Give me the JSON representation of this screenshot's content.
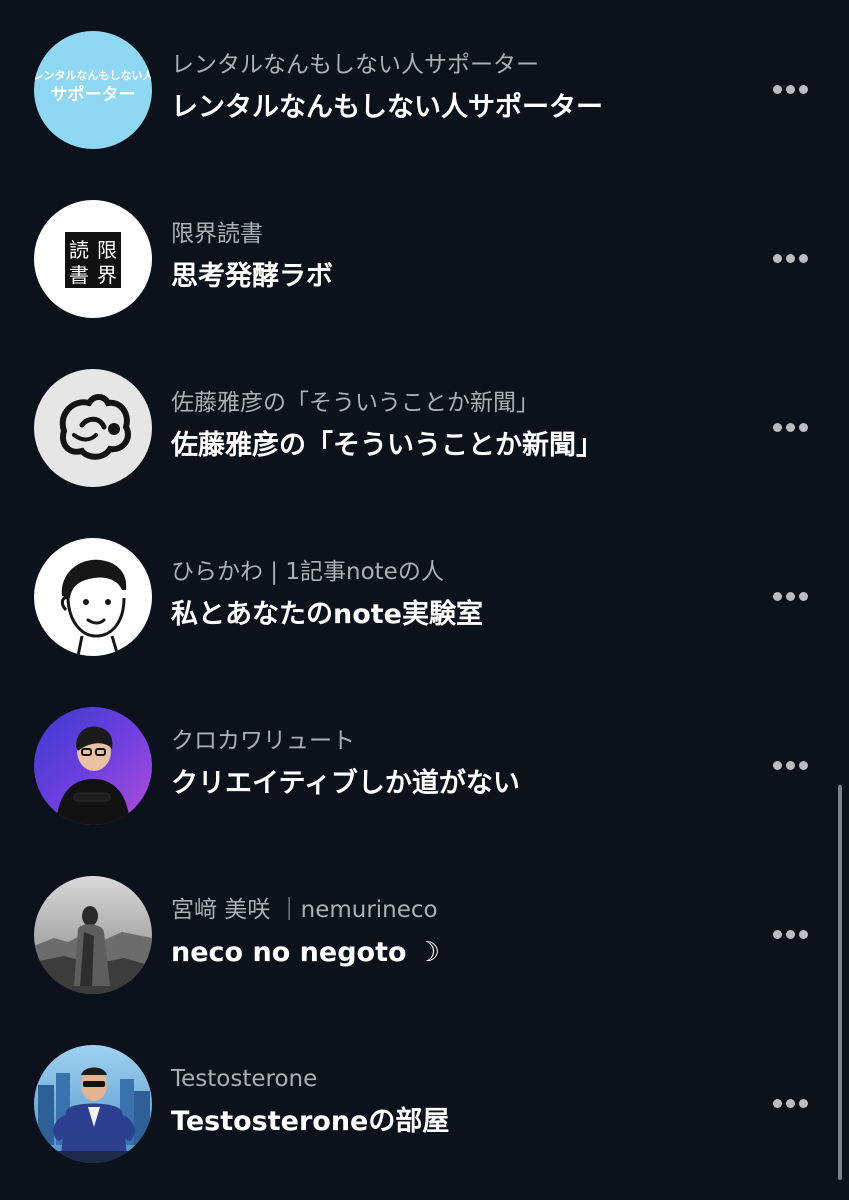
{
  "items": [
    {
      "author": "レンタルなんもしない人サポーター",
      "title": "レンタルなんもしない人サポーター",
      "avatar_text": [
        "レンタルなんもしない人",
        "サポーター"
      ],
      "avatar_icon": "text-logo-icon"
    },
    {
      "author": "限界読書",
      "title": "思考発酵ラボ",
      "avatar_text": [
        "読",
        "限",
        "書",
        "界"
      ],
      "avatar_icon": "book-logo-icon"
    },
    {
      "author": "佐藤雅彦の「そういうことか新聞」",
      "title": "佐藤雅彦の「そういうことか新聞」",
      "avatar_icon": "ink-drawing-icon"
    },
    {
      "author": "ひらかわ | 1記事noteの人",
      "title": "私とあなたのnote実験室",
      "avatar_icon": "face-illustration-icon"
    },
    {
      "author": "クロカワリュート",
      "title": "クリエイティブしか道がない",
      "avatar_icon": "person-photo-icon"
    },
    {
      "author": "宮﨑 美咲 ｜nemurineco",
      "title": "neco no negoto ☽",
      "avatar_icon": "monochrome-photo-icon"
    },
    {
      "author": "Testosterone",
      "title": "Testosteroneの部屋",
      "avatar_icon": "cartoon-muscle-icon"
    }
  ],
  "colors": {
    "background": "#0b121b",
    "author_text": "#a9b0b8",
    "title_text": "#ffffff",
    "more_dots": "#b9bec4"
  }
}
